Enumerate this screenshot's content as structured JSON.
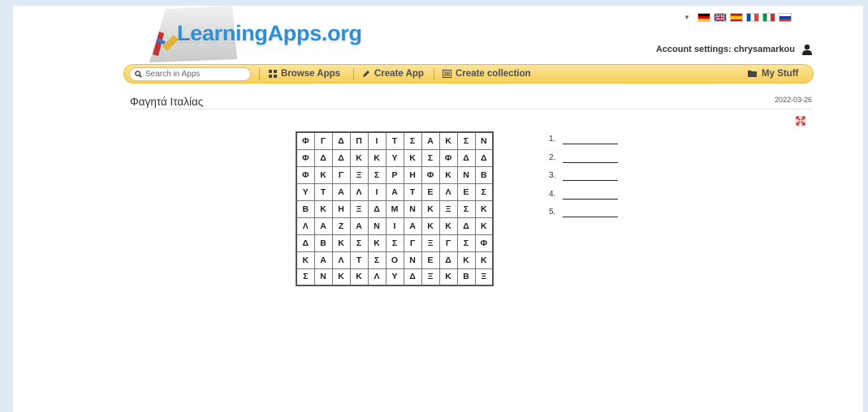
{
  "header": {
    "logo_text": "LearningApps.org",
    "account_label": "Account settings: chrysamarkou",
    "flags": [
      "de-flag",
      "gb-flag",
      "es-flag",
      "fr-flag",
      "it-flag",
      "ru-flag"
    ]
  },
  "nav": {
    "search_placeholder": "Search in Apps",
    "browse": "Browse Apps",
    "create": "Create App",
    "collection": "Create collection",
    "mystuff": "My Stuff"
  },
  "app": {
    "title": "Φαγητά Ιταλίας",
    "date": "2022-03-26"
  },
  "grid": [
    [
      "Φ",
      "Γ",
      "Δ",
      "Π",
      "Ι",
      "Τ",
      "Σ",
      "Α",
      "Κ",
      "Σ",
      "Ν"
    ],
    [
      "Φ",
      "Δ",
      "Δ",
      "Κ",
      "Κ",
      "Υ",
      "Κ",
      "Σ",
      "Φ",
      "Δ",
      "Δ"
    ],
    [
      "Φ",
      "Κ",
      "Γ",
      "Ξ",
      "Σ",
      "Ρ",
      "Η",
      "Φ",
      "Κ",
      "Ν",
      "Β"
    ],
    [
      "Υ",
      "Τ",
      "Α",
      "Λ",
      "Ι",
      "Α",
      "Τ",
      "Ε",
      "Λ",
      "Ε",
      "Σ"
    ],
    [
      "Β",
      "Κ",
      "Η",
      "Ξ",
      "Δ",
      "Μ",
      "Ν",
      "Κ",
      "Ξ",
      "Σ",
      "Κ"
    ],
    [
      "Λ",
      "Α",
      "Ζ",
      "Α",
      "Ν",
      "Ι",
      "Α",
      "Κ",
      "Κ",
      "Δ",
      "Κ"
    ],
    [
      "Δ",
      "Β",
      "Κ",
      "Σ",
      "Κ",
      "Σ",
      "Γ",
      "Ξ",
      "Γ",
      "Σ",
      "Φ"
    ],
    [
      "Κ",
      "Α",
      "Λ",
      "Τ",
      "Σ",
      "Ο",
      "Ν",
      "Ε",
      "Δ",
      "Κ",
      "Κ"
    ],
    [
      "Σ",
      "Ν",
      "Κ",
      "Κ",
      "Λ",
      "Υ",
      "Δ",
      "Ξ",
      "Κ",
      "Β",
      "Ξ"
    ]
  ],
  "answers": [
    "1.",
    "2.",
    "3.",
    "4.",
    "5."
  ],
  "colors": {
    "accent": "#2b8fd6",
    "navbar": "#f7cf5a",
    "background": "#dfe9f3"
  }
}
